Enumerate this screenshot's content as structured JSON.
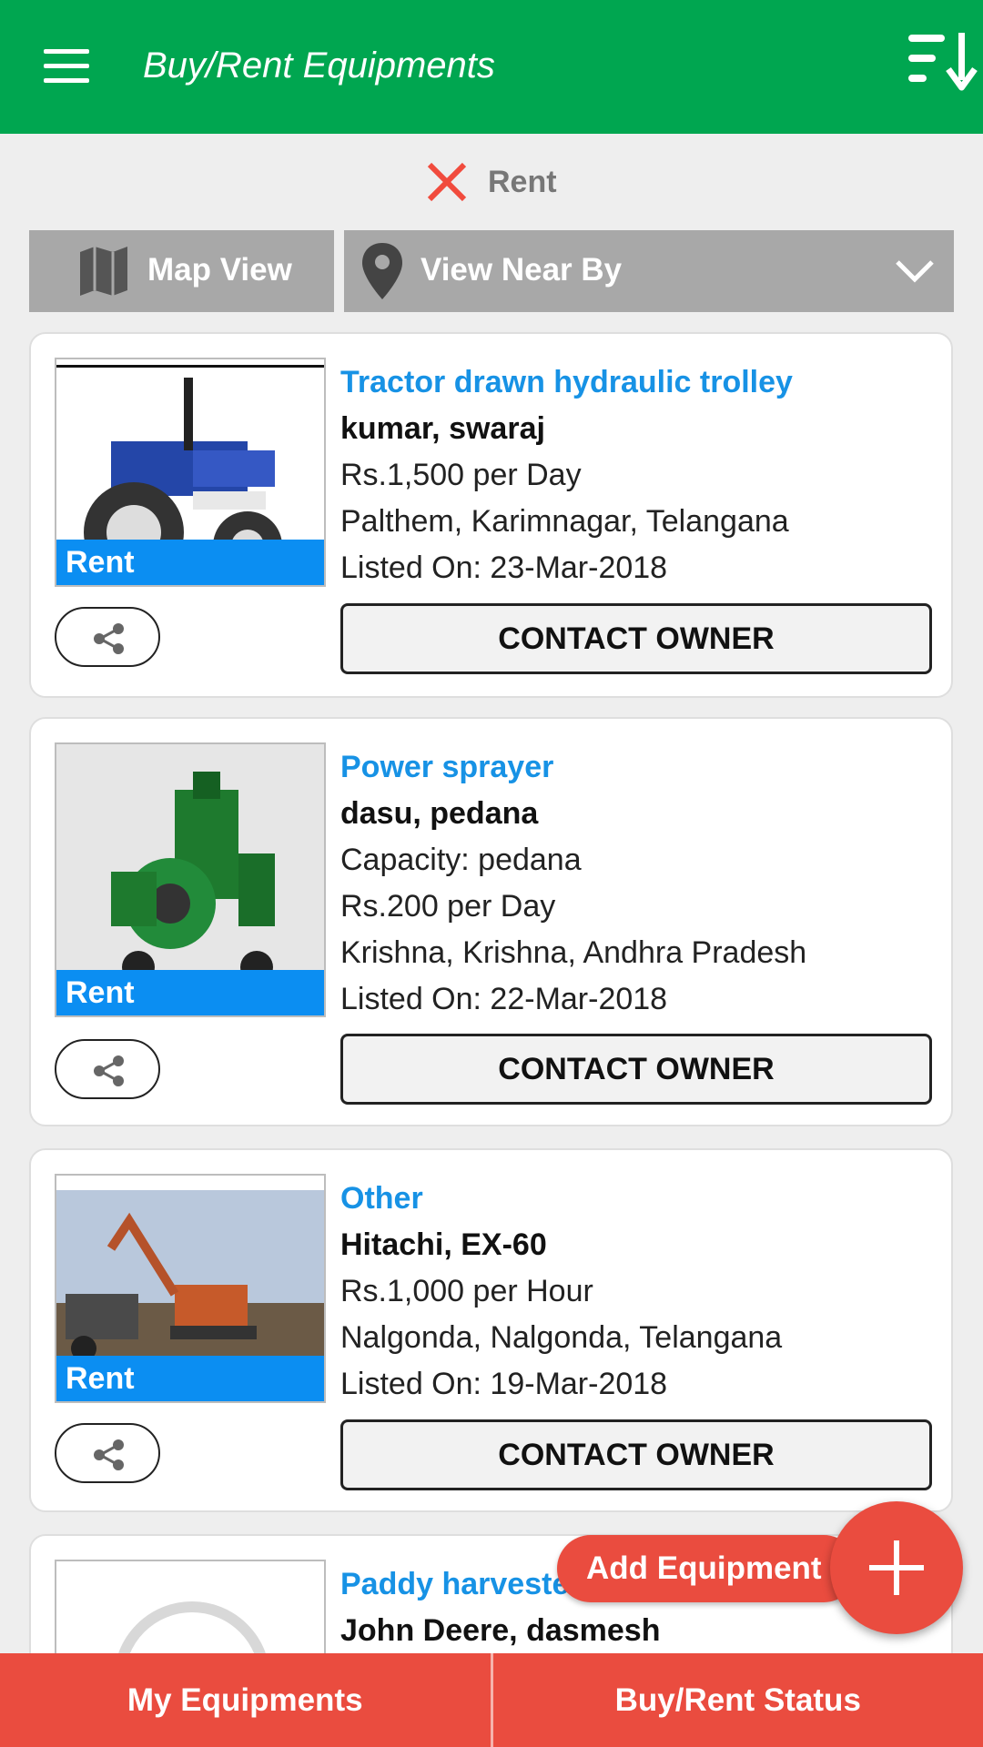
{
  "header": {
    "title": "Buy/Rent Equipments",
    "menu_icon": "hamburger-menu-icon",
    "sort_icon": "sort-descending-icon",
    "color": "#00a650"
  },
  "filter": {
    "label": "Rent",
    "clear_icon": "close-icon"
  },
  "view_bar": {
    "map_view_label": "Map View",
    "near_by_label": "View Near By"
  },
  "listings": [
    {
      "name": "Tractor drawn hydraulic trolley",
      "brand": "kumar, swaraj",
      "line3": "Rs.1,500 per Day",
      "line4": "Palthem, Karimnagar, Telangana",
      "line5": "Listed On: 23-Mar-2018",
      "tag": "Rent",
      "image": "blue-tractor-image"
    },
    {
      "name": "Power sprayer",
      "brand": "dasu, pedana",
      "line3": "Capacity: pedana",
      "line4": "Rs.200 per Day",
      "line5": "Krishna, Krishna, Andhra Pradesh",
      "line6": "Listed On: 22-Mar-2018",
      "tag": "Rent",
      "image": "green-power-sprayer-image"
    },
    {
      "name": "Other",
      "brand": "Hitachi, EX-60",
      "line3": "Rs.1,000 per Hour",
      "line4": "Nalgonda, Nalgonda, Telangana",
      "line5": "Listed On: 19-Mar-2018",
      "tag": "Rent",
      "image": "excavator-image"
    },
    {
      "name": "Paddy harveste",
      "brand": "John Deere, dasmesh",
      "image": "placeholder-logo-image"
    }
  ],
  "contact_label": "CONTACT OWNER",
  "fab": {
    "label": "Add Equipment",
    "color": "#ea4c3f"
  },
  "bottom_nav": {
    "left": "My Equipments",
    "right": "Buy/Rent Status"
  },
  "colors": {
    "link_blue": "#1792e5",
    "rent_tag": "#0b8ef2",
    "accent_red": "#ea4c3f"
  }
}
